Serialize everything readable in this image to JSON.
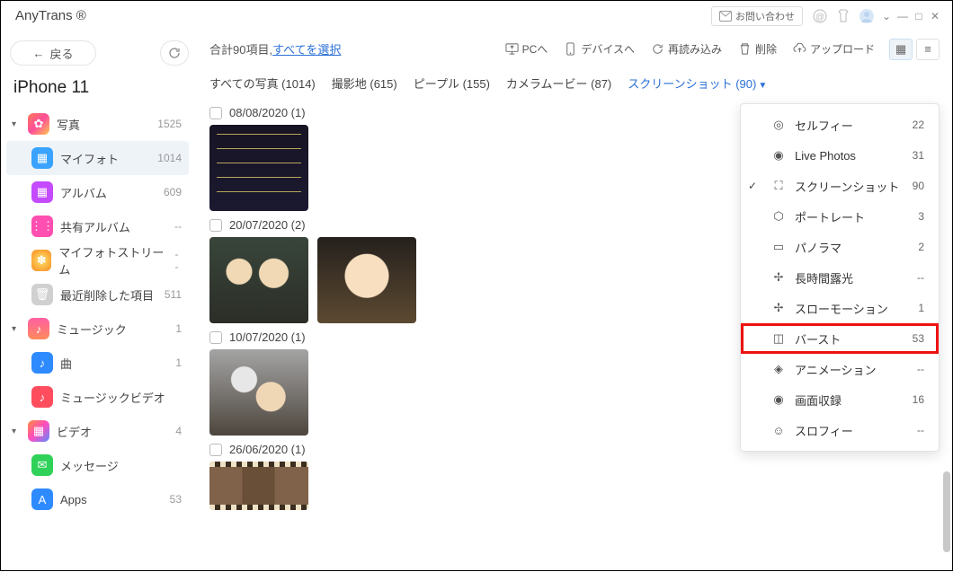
{
  "app_name": "AnyTrans ®",
  "titlebar": {
    "contact_label": "お問い合わせ"
  },
  "back_label": "戻る",
  "device_name": "iPhone 11",
  "sidebar": [
    {
      "type": "group",
      "caret": true,
      "icon_bg": "linear-gradient(135deg,#ff7a59,#ff4e9b,#ffc94a)",
      "glyph": "✿",
      "label": "写真",
      "count": "1525"
    },
    {
      "type": "child",
      "active": true,
      "icon_bg": "#3aa3ff",
      "glyph": "▦",
      "label": "マイフォト",
      "count": "1014"
    },
    {
      "type": "child",
      "icon_bg": "#c44bff",
      "glyph": "▦",
      "label": "アルバム",
      "count": "609"
    },
    {
      "type": "child",
      "icon_bg": "#ff4fb0",
      "glyph": "⋮⋮",
      "label": "共有アルバム",
      "count": "--"
    },
    {
      "type": "child",
      "icon_bg": "radial-gradient(circle,#ffe36b,#f78b1f)",
      "glyph": "✽",
      "label": "マイフォトストリーム",
      "count": "--"
    },
    {
      "type": "child",
      "icon_bg": "#d0d0d0",
      "glyph": "🗑",
      "label": "最近削除した項目",
      "count": "511"
    },
    {
      "type": "group",
      "caret": true,
      "icon_bg": "linear-gradient(180deg,#ff5fa2,#ff8b5a)",
      "glyph": "♪",
      "label": "ミュージック",
      "count": "1"
    },
    {
      "type": "child",
      "icon_bg": "#2e8bff",
      "glyph": "♪",
      "label": "曲",
      "count": "1"
    },
    {
      "type": "child",
      "icon_bg": "#ff4d5e",
      "glyph": "♪",
      "label": "ミュージックビデオ",
      "count": ""
    },
    {
      "type": "group",
      "caret": true,
      "icon_bg": "linear-gradient(135deg,#ff8b3d,#ff4dc0,#5a8bff)",
      "glyph": "▦",
      "label": "ビデオ",
      "count": "4"
    },
    {
      "type": "child",
      "icon_bg": "#30d158",
      "glyph": "✉",
      "label": "メッセージ",
      "count": ""
    },
    {
      "type": "child",
      "icon_bg": "#2e8bff",
      "glyph": "A",
      "label": "Apps",
      "count": "53"
    }
  ],
  "toolbar": {
    "summary_prefix": "合計90項目,",
    "select_all": "すべてを選択",
    "pc": "PCへ",
    "device": "デバイスへ",
    "reload": "再読み込み",
    "delete": "削除",
    "upload": "アップロード"
  },
  "tabs": [
    {
      "label": "すべての写真 (1014)"
    },
    {
      "label": "撮影地 (615)"
    },
    {
      "label": "ピープル (155)"
    },
    {
      "label": "カメラムービー (87)"
    },
    {
      "label": "スクリーンショット (90)",
      "active": true,
      "dropdown": true
    }
  ],
  "groups": [
    {
      "date": "08/08/2020 (1)",
      "thumbs": [
        "dark"
      ]
    },
    {
      "date": "20/07/2020 (2)",
      "thumbs": [
        "anime1",
        "anime2"
      ]
    },
    {
      "date": "10/07/2020 (1)",
      "thumbs": [
        "anime3"
      ]
    },
    {
      "date": "26/06/2020 (1)",
      "thumbs": [
        "strip"
      ]
    }
  ],
  "dropdown": [
    {
      "icon": "◎",
      "label": "セルフィー",
      "count": "22"
    },
    {
      "icon": "◉",
      "label": "Live Photos",
      "count": "31"
    },
    {
      "icon": "⛶",
      "label": "スクリーンショット",
      "count": "90",
      "selected": true
    },
    {
      "icon": "⬡",
      "label": "ポートレート",
      "count": "3"
    },
    {
      "icon": "▭",
      "label": "パノラマ",
      "count": "2"
    },
    {
      "icon": "✢",
      "label": "長時間露光",
      "count": "--"
    },
    {
      "icon": "✢",
      "label": "スローモーション",
      "count": "1"
    },
    {
      "icon": "◫",
      "label": "バースト",
      "count": "53",
      "highlight": true
    },
    {
      "icon": "◈",
      "label": "アニメーション",
      "count": "--"
    },
    {
      "icon": "◉",
      "label": "画面収録",
      "count": "16"
    },
    {
      "icon": "☺",
      "label": "スロフィー",
      "count": "--"
    }
  ]
}
